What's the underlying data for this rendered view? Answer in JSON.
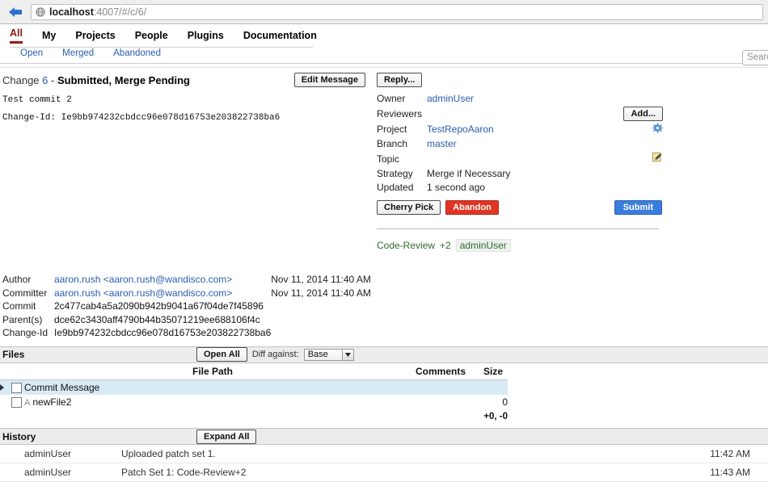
{
  "browser": {
    "back_icon": "back-arrow-icon",
    "favicon": "globe-icon",
    "url_host": "localhost",
    "url_rest": ":4007/#/c/6/"
  },
  "nav": {
    "tabs": [
      {
        "label": "All",
        "active": true
      },
      {
        "label": "My",
        "active": false
      },
      {
        "label": "Projects",
        "active": false
      },
      {
        "label": "People",
        "active": false
      },
      {
        "label": "Plugins",
        "active": false
      },
      {
        "label": "Documentation",
        "active": false
      }
    ],
    "sub_tabs": [
      {
        "label": "Open"
      },
      {
        "label": "Merged"
      },
      {
        "label": "Abandoned"
      }
    ],
    "search_placeholder": "Search"
  },
  "change": {
    "prefix": "Change",
    "number": "6",
    "dash": "-",
    "status": "Submitted, Merge Pending",
    "edit_message_label": "Edit Message",
    "commit_subject": "Test commit 2",
    "commit_changeid_line": "Change-Id: Ie9bb974232cbdcc96e078d16753e203822738ba6"
  },
  "side": {
    "reply_label": "Reply...",
    "add_label": "Add...",
    "rows": [
      {
        "label": "Owner",
        "value": "adminUser",
        "is_link": true
      },
      {
        "label": "Reviewers",
        "value": "",
        "is_link": false
      },
      {
        "label": "Project",
        "value": "TestRepoAaron",
        "is_link": true
      },
      {
        "label": "Branch",
        "value": "master",
        "is_link": true
      },
      {
        "label": "Topic",
        "value": "",
        "is_link": false
      },
      {
        "label": "Strategy",
        "value": "Merge if Necessary",
        "is_link": false
      },
      {
        "label": "Updated",
        "value": "1 second ago",
        "is_link": false
      }
    ],
    "project_icon": "gear-icon",
    "topic_edit_icon": "edit-pencil-icon",
    "cherry_pick_label": "Cherry Pick",
    "abandon_label": "Abandon",
    "submit_label": "Submit",
    "approval": {
      "label": "Code-Review",
      "score": "+2",
      "user": "adminUser",
      "color": "#2f6b2f"
    }
  },
  "meta": {
    "rows": [
      {
        "label": "Author",
        "person": "aaron.rush <aaron.rush@wandisco.com>",
        "date": "Nov 11, 2014 11:40 AM",
        "is_link": true
      },
      {
        "label": "Committer",
        "person": "aaron.rush <aaron.rush@wandisco.com>",
        "date": "Nov 11, 2014 11:40 AM",
        "is_link": true
      },
      {
        "label": "Commit",
        "person": "2c477cab4a5a2090b942b9041a67f04de7f45896",
        "date": "",
        "is_link": false
      },
      {
        "label": "Parent(s)",
        "person": "dce62c3430aff4790b44b35071219ee688106f4c",
        "date": "",
        "is_link": false
      },
      {
        "label": "Change-Id",
        "person": "Ie9bb974232cbdcc96e078d16753e203822738ba6",
        "date": "",
        "is_link": false
      }
    ]
  },
  "files": {
    "section_title": "Files",
    "open_all_label": "Open All",
    "diff_against_label": "Diff against:",
    "diff_against_value": "Base",
    "columns": {
      "file_path": "File Path",
      "comments": "Comments",
      "size": "Size"
    },
    "rows": [
      {
        "expander": true,
        "status": "",
        "path": "Commit Message",
        "comments": "",
        "size": "",
        "highlight": true
      },
      {
        "expander": false,
        "status": "A",
        "path": "newFile2",
        "comments": "",
        "size": "0",
        "highlight": false
      }
    ],
    "totals": "+0, -0"
  },
  "history": {
    "section_title": "History",
    "expand_all_label": "Expand All",
    "rows": [
      {
        "user": "adminUser",
        "message": "Uploaded patch set 1.",
        "time": "11:42 AM"
      },
      {
        "user": "adminUser",
        "message": "Patch Set 1: Code-Review+2",
        "time": "11:43 AM"
      }
    ]
  }
}
